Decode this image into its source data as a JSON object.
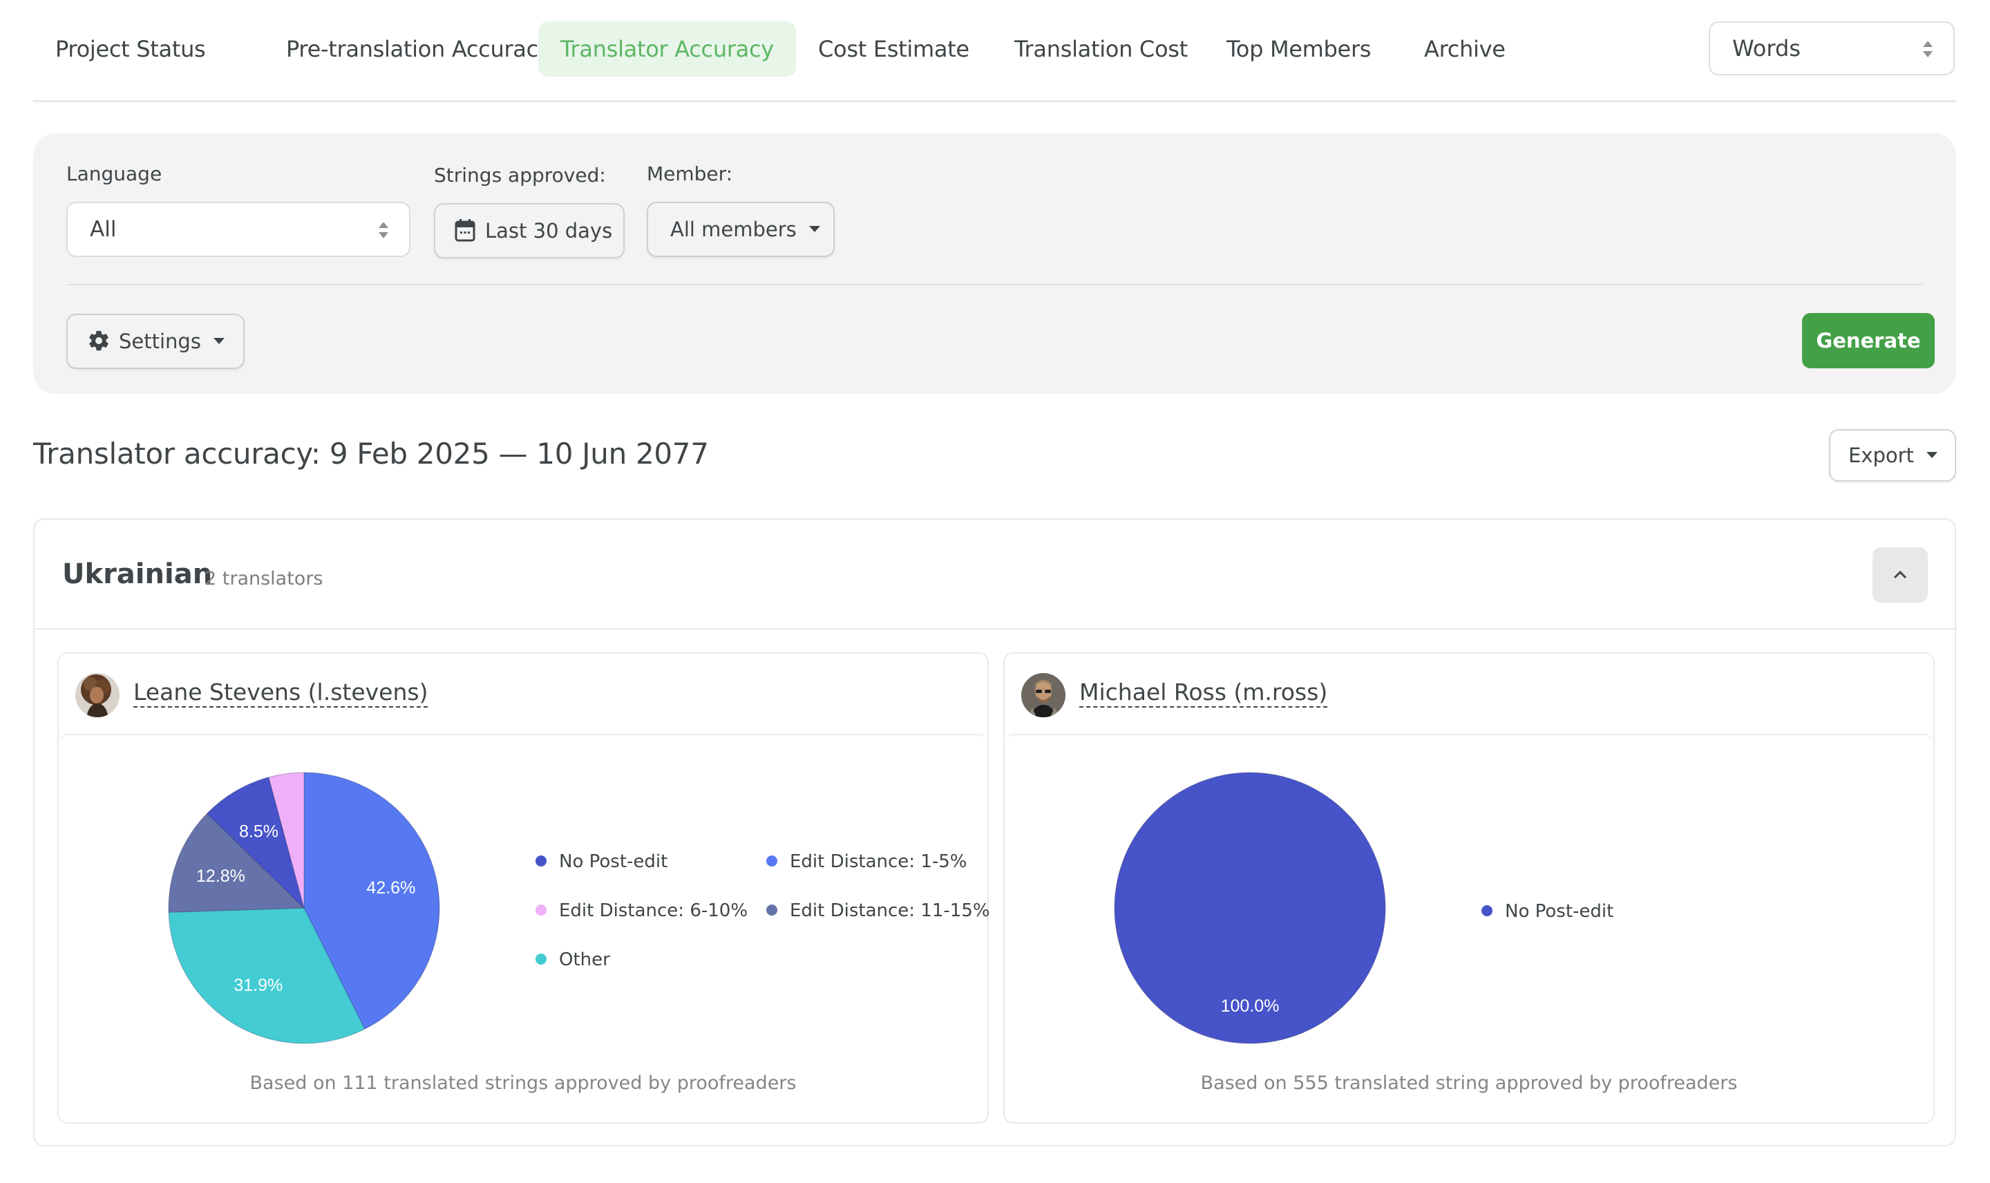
{
  "nav": {
    "tabs": [
      {
        "label": "Project Status",
        "active": false
      },
      {
        "label": "Pre-translation Accuracy",
        "active": false
      },
      {
        "label": "Translator Accuracy",
        "active": true
      },
      {
        "label": "Cost Estimate",
        "active": false
      },
      {
        "label": "Translation Cost",
        "active": false
      },
      {
        "label": "Top Members",
        "active": false
      },
      {
        "label": "Archive",
        "active": false
      }
    ],
    "units_select": {
      "value": "Words"
    }
  },
  "filters": {
    "language": {
      "label": "Language",
      "value": "All"
    },
    "strings_approved": {
      "label": "Strings approved:",
      "value": "Last 30 days",
      "icon": "calendar-icon"
    },
    "member": {
      "label": "Member:",
      "value": "All members"
    },
    "settings_label": "Settings",
    "generate_label": "Generate"
  },
  "report": {
    "title": "Translator accuracy: 9 Feb 2025 — 10 Jun 2077",
    "export_label": "Export"
  },
  "language_group": {
    "name": "Ukrainian",
    "count_label": "2 translators",
    "translators": [
      {
        "name": "Leane Stevens (l.stevens)",
        "footnote": "Based on 111 translated strings approved by proofreaders"
      },
      {
        "name": "Michael Ross (m.ross)",
        "footnote": "Based on 555 translated string approved by proofreaders"
      }
    ]
  },
  "colors": {
    "accent_green": "#43a047",
    "active_tab_bg": "#e8f5e9",
    "active_tab_text": "#5cb765"
  },
  "chart_data": [
    {
      "type": "pie",
      "title": "Leane Stevens (l.stevens)",
      "legend_position": "right",
      "slices": [
        {
          "label": "Edit Distance: 1-5%",
          "value": 42.6,
          "color": "#5679f1",
          "data_label": "42.6%"
        },
        {
          "label": "Other",
          "value": 31.9,
          "color": "#43ccd3",
          "data_label": "31.9%"
        },
        {
          "label": "Edit Distance: 11-15%",
          "value": 12.8,
          "color": "#6673aa",
          "data_label": "12.8%"
        },
        {
          "label": "No Post-edit",
          "value": 8.5,
          "color": "#4653c9",
          "data_label": "8.5%"
        },
        {
          "label": "Edit Distance: 6-10%",
          "value": 4.2,
          "color": "#f0b0f9",
          "data_label": ""
        }
      ],
      "legend": [
        {
          "label": "No Post-edit",
          "color": "#4653c9"
        },
        {
          "label": "Edit Distance: 1-5%",
          "color": "#5679f1"
        },
        {
          "label": "Edit Distance: 6-10%",
          "color": "#f0b0f9"
        },
        {
          "label": "Edit Distance: 11-15%",
          "color": "#6673aa"
        },
        {
          "label": "Other",
          "color": "#43ccd3"
        }
      ]
    },
    {
      "type": "pie",
      "title": "Michael Ross (m.ross)",
      "legend_position": "right",
      "slices": [
        {
          "label": "No Post-edit",
          "value": 100.0,
          "color": "#4653c9",
          "data_label": "100.0%"
        }
      ],
      "legend": [
        {
          "label": "No Post-edit",
          "color": "#4653c9"
        }
      ]
    }
  ]
}
